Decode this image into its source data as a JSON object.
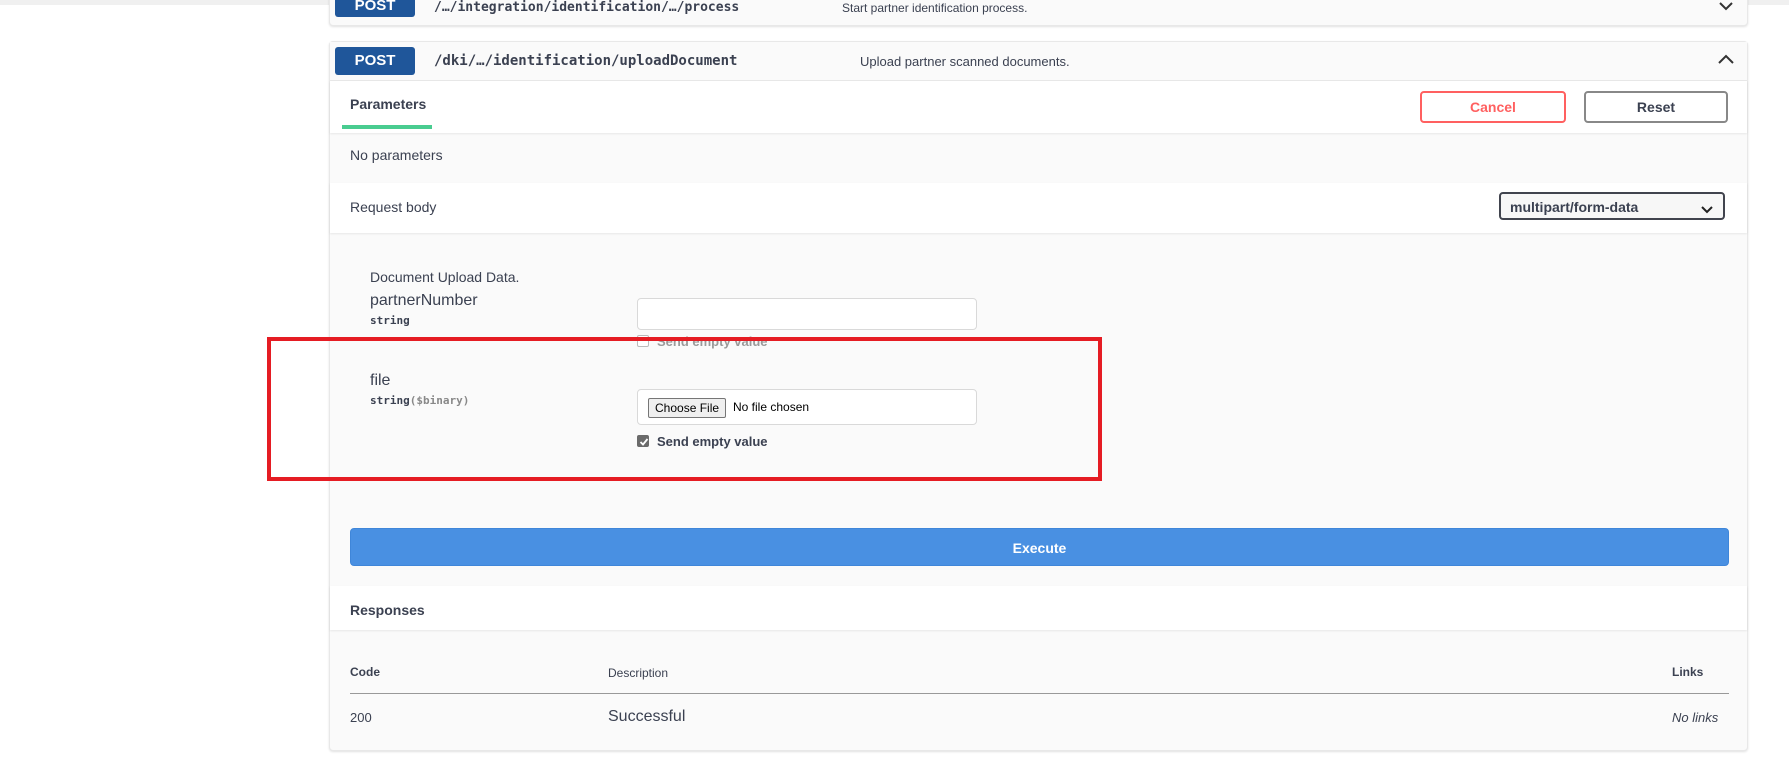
{
  "previous_operation": {
    "method": "POST",
    "path": "/…/integration/identification/…/process",
    "description": "Start partner identification process."
  },
  "operation": {
    "method": "POST",
    "path": "/dki/…/identification/uploadDocument",
    "description": "Upload partner scanned documents.",
    "expanded": true
  },
  "parameters": {
    "tab_label": "Parameters",
    "cancel_label": "Cancel",
    "reset_label": "Reset",
    "empty_text": "No parameters"
  },
  "request_body": {
    "label": "Request body",
    "content_type": "multipart/form-data",
    "description": "Document Upload Data.",
    "fields": [
      {
        "name": "partnerNumber",
        "type": "string",
        "format": "",
        "value": "",
        "send_empty_label": "Send empty value",
        "send_empty_checked": false,
        "send_empty_disabled": true
      },
      {
        "name": "file",
        "type": "string",
        "format": "($binary)",
        "choose_label": "Choose File",
        "no_file_text": "No file chosen",
        "send_empty_label": "Send empty value",
        "send_empty_checked": true
      }
    ]
  },
  "execute_label": "Execute",
  "responses": {
    "title": "Responses",
    "columns": [
      "Code",
      "Description",
      "Links"
    ],
    "rows": [
      {
        "code": "200",
        "description": "Successful",
        "links": "No links"
      }
    ]
  },
  "colors": {
    "method_post": "#1f569a",
    "execute": "#4990e2",
    "cancel": "#ff6060",
    "tab_underline": "#49cc90",
    "highlight": "#e51c23"
  }
}
